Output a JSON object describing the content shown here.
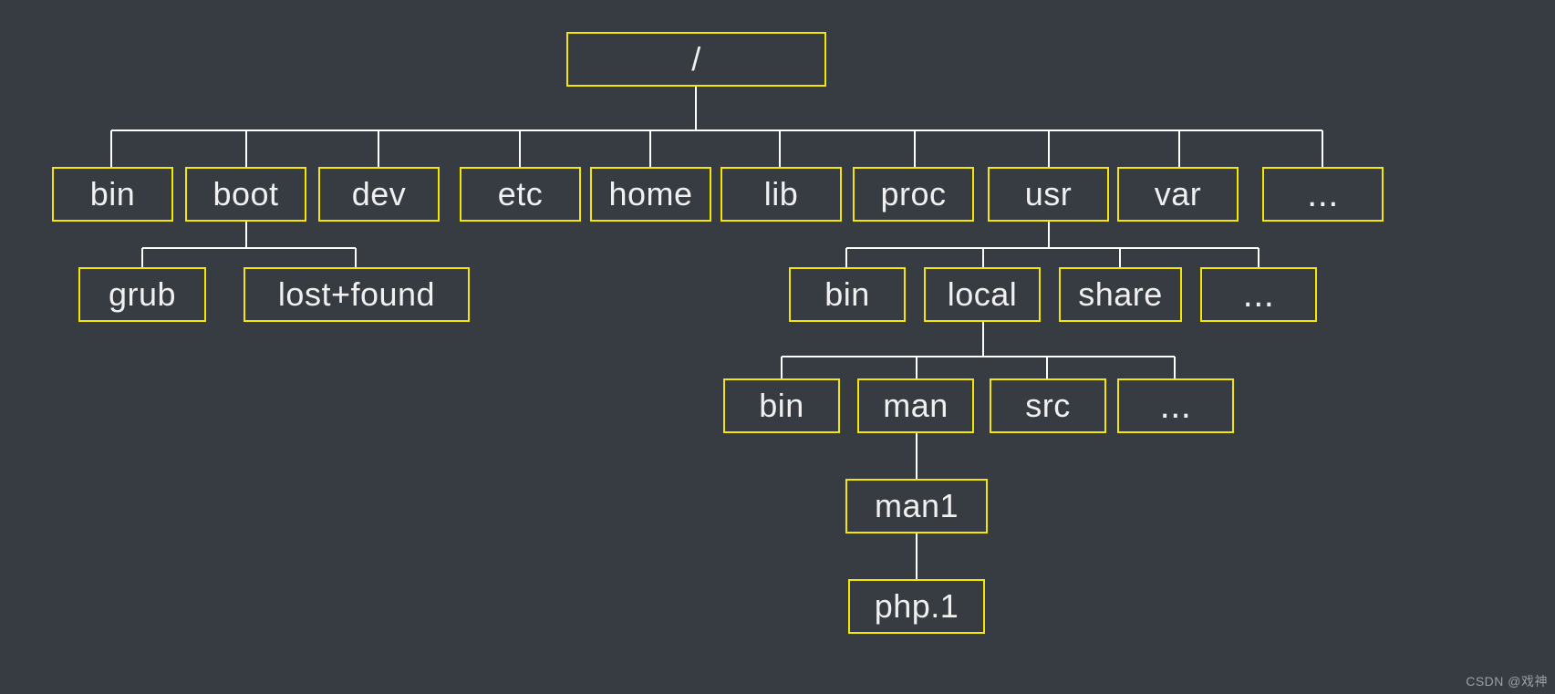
{
  "diagram_type": "filesystem-tree",
  "root": {
    "label": "/"
  },
  "level1": {
    "bin": {
      "label": "bin"
    },
    "boot": {
      "label": "boot"
    },
    "dev": {
      "label": "dev"
    },
    "etc": {
      "label": "etc"
    },
    "home": {
      "label": "home"
    },
    "lib": {
      "label": "lib"
    },
    "proc": {
      "label": "proc"
    },
    "usr": {
      "label": "usr"
    },
    "var": {
      "label": "var"
    },
    "more": {
      "label": "..."
    }
  },
  "boot_children": {
    "grub": {
      "label": "grub"
    },
    "lostfound": {
      "label": "lost+found"
    }
  },
  "usr_children": {
    "bin": {
      "label": "bin"
    },
    "local": {
      "label": "local"
    },
    "share": {
      "label": "share"
    },
    "more": {
      "label": "..."
    }
  },
  "local_children": {
    "bin": {
      "label": "bin"
    },
    "man": {
      "label": "man"
    },
    "src": {
      "label": "src"
    },
    "more": {
      "label": "..."
    }
  },
  "man_children": {
    "man1": {
      "label": "man1"
    }
  },
  "man1_children": {
    "php1": {
      "label": "php.1"
    }
  },
  "watermark": "CSDN @戏神"
}
